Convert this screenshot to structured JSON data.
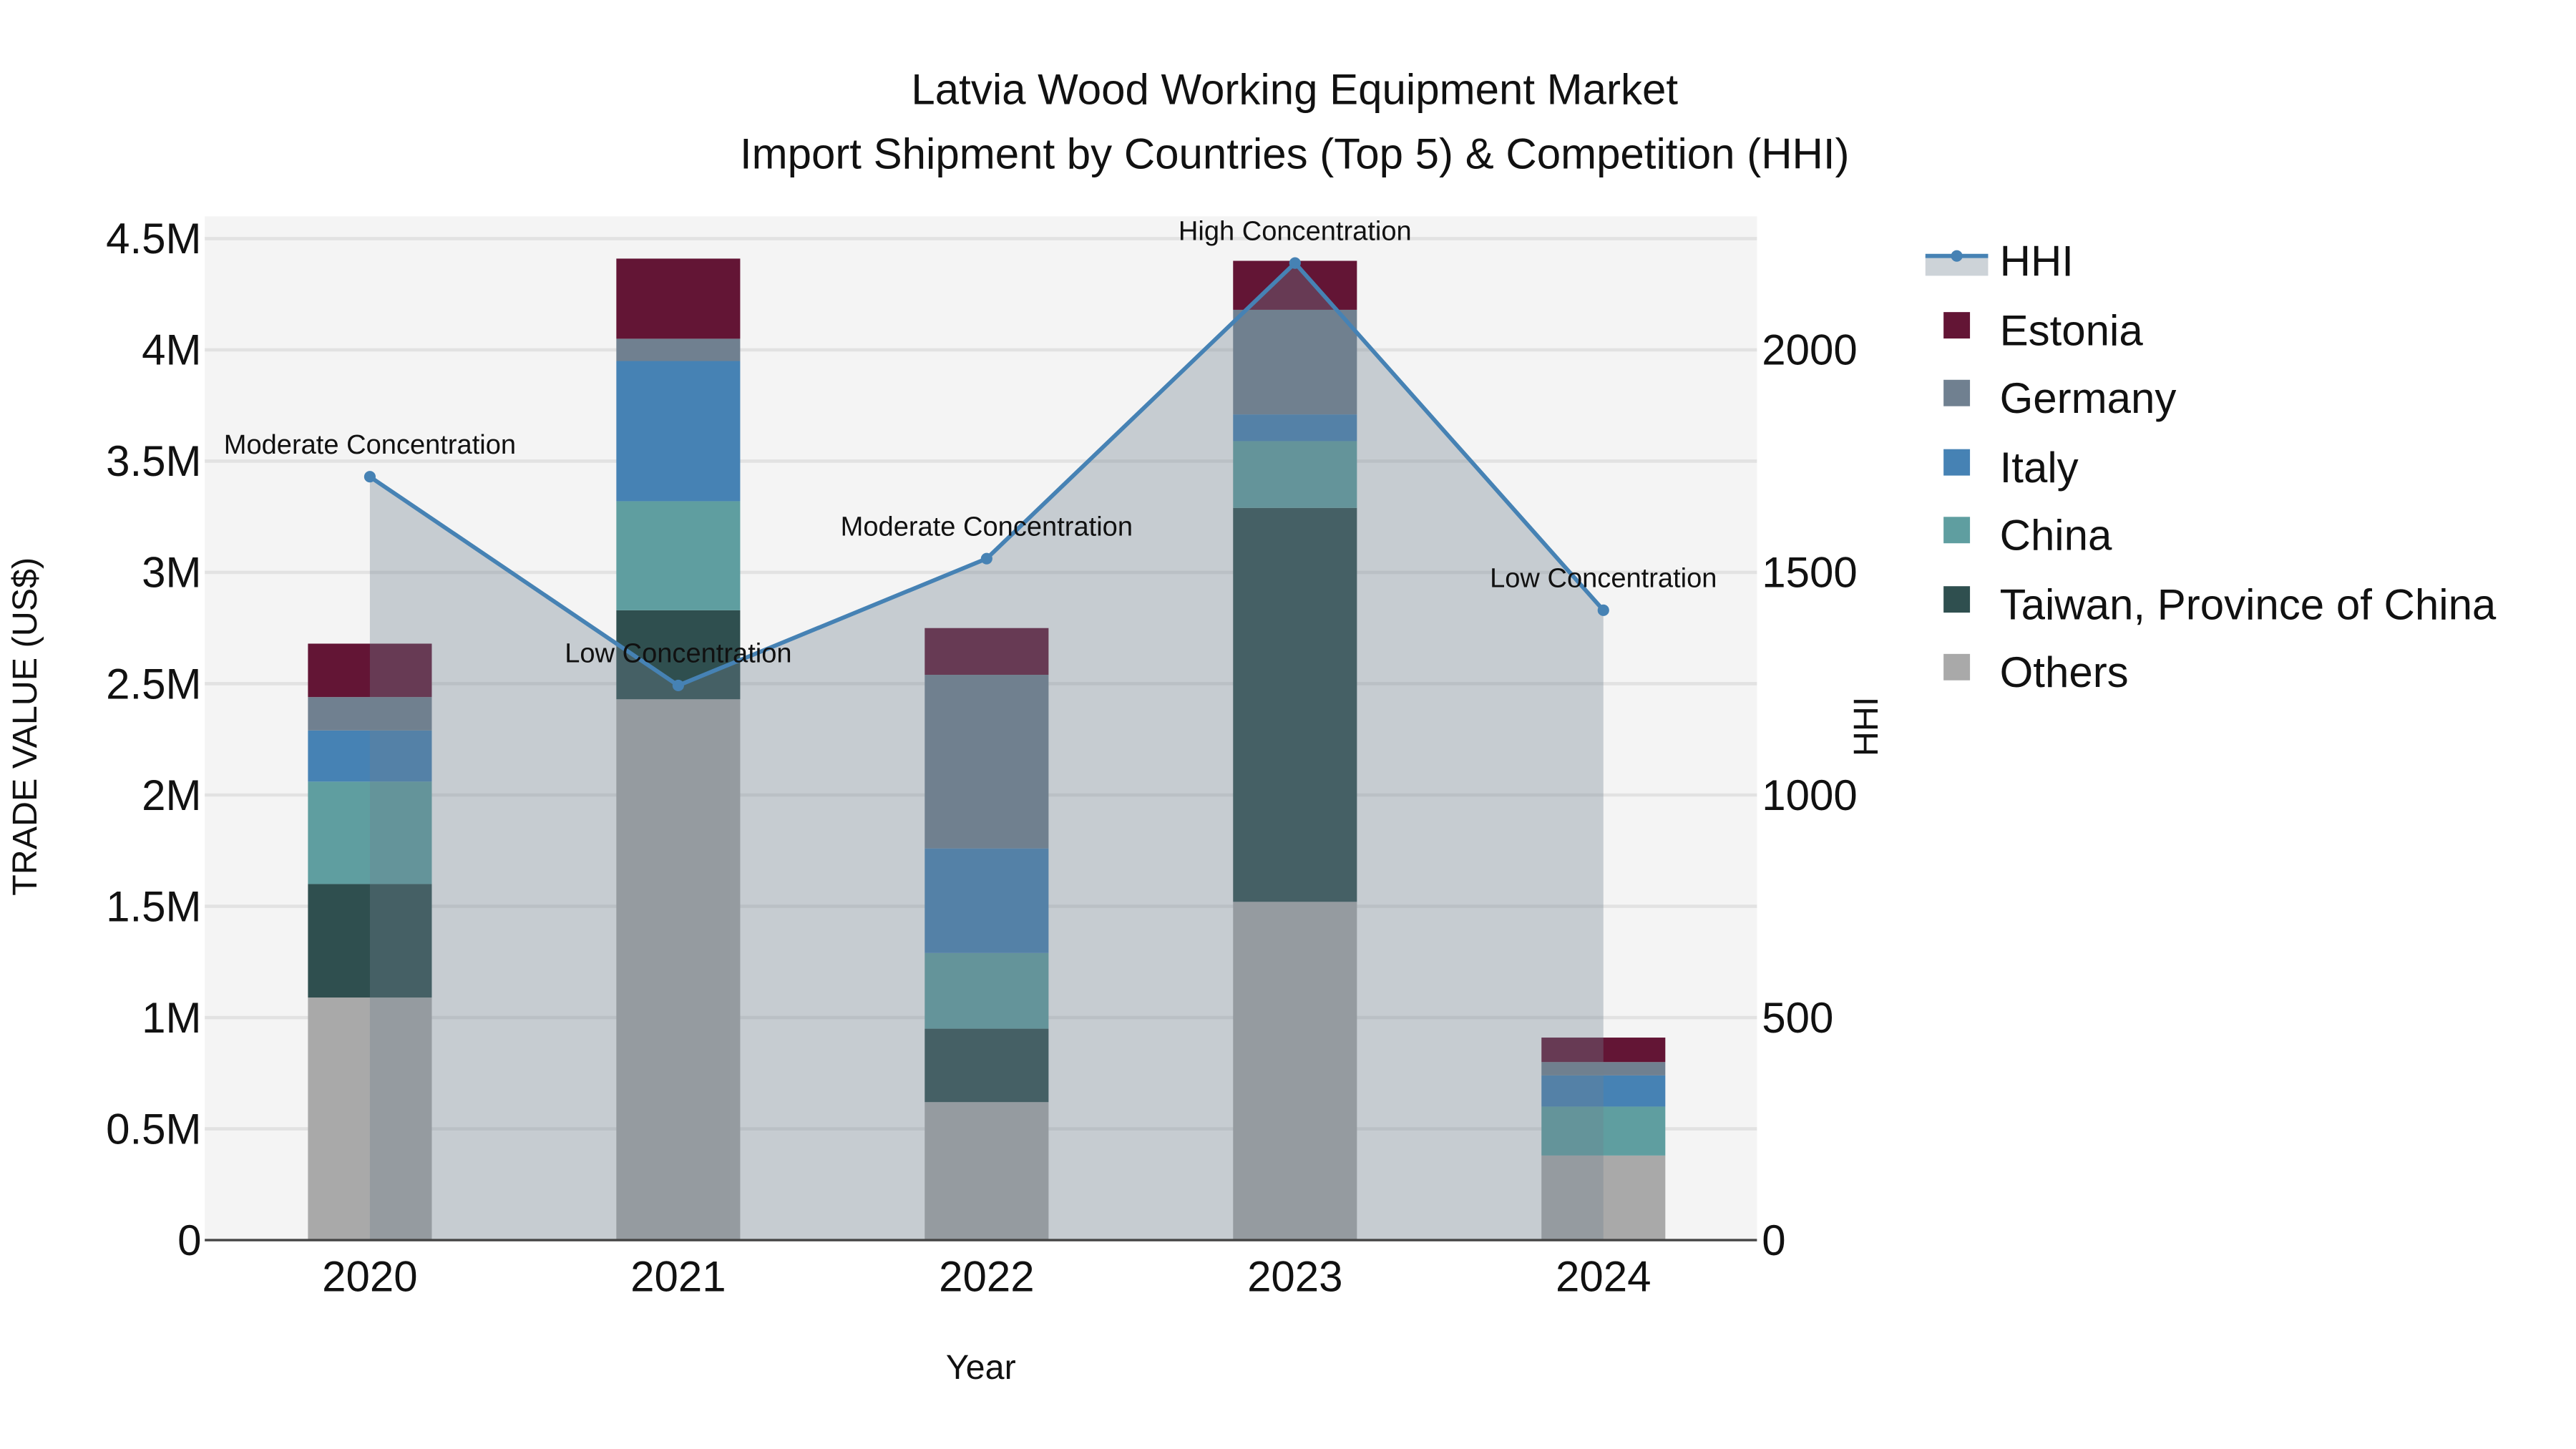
{
  "chart_data": {
    "type": "bar",
    "title": "Latvia Wood Working Equipment Market",
    "subtitle": "Import Shipment by Countries (Top 5) & Competition (HHI)",
    "xlabel": "Year",
    "ylabel": "TRADE VALUE (US$)",
    "y2label": "HHI",
    "categories": [
      "2020",
      "2021",
      "2022",
      "2023",
      "2024"
    ],
    "ylim": [
      0,
      4600000
    ],
    "y2lim": [
      0,
      2300
    ],
    "yticks": [
      {
        "value": 0,
        "label": "0"
      },
      {
        "value": 500000,
        "label": "0.5M"
      },
      {
        "value": 1000000,
        "label": "1M"
      },
      {
        "value": 1500000,
        "label": "1.5M"
      },
      {
        "value": 2000000,
        "label": "2M"
      },
      {
        "value": 2500000,
        "label": "2.5M"
      },
      {
        "value": 3000000,
        "label": "3M"
      },
      {
        "value": 3500000,
        "label": "3.5M"
      },
      {
        "value": 4000000,
        "label": "4M"
      },
      {
        "value": 4500000,
        "label": "4.5M"
      }
    ],
    "y2ticks": [
      {
        "value": 0,
        "label": "0"
      },
      {
        "value": 500,
        "label": "500"
      },
      {
        "value": 1000,
        "label": "1000"
      },
      {
        "value": 1500,
        "label": "1500"
      },
      {
        "value": 2000,
        "label": "2000"
      }
    ],
    "series": [
      {
        "name": "Others",
        "color": "#a9a9a9",
        "values": [
          1090000,
          2430000,
          620000,
          1520000,
          380000
        ]
      },
      {
        "name": "Taiwan, Province of China",
        "color": "#2f4f4f",
        "values": [
          510000,
          400000,
          330000,
          1770000,
          0
        ]
      },
      {
        "name": "China",
        "color": "#5f9ea0",
        "values": [
          460000,
          490000,
          340000,
          300000,
          220000
        ]
      },
      {
        "name": "Italy",
        "color": "#4682b4",
        "values": [
          230000,
          630000,
          470000,
          120000,
          140000
        ]
      },
      {
        "name": "Germany",
        "color": "#708090",
        "values": [
          150000,
          100000,
          780000,
          470000,
          60000
        ]
      },
      {
        "name": "Estonia",
        "color": "#631535",
        "values": [
          240000,
          360000,
          210000,
          220000,
          110000
        ]
      }
    ],
    "hhi": {
      "name": "HHI",
      "color": "#4682b4",
      "values": [
        1715,
        1246,
        1531,
        2195,
        1415
      ],
      "annotations": [
        "Moderate Concentration",
        "Low Concentration",
        "Moderate Concentration",
        "High Concentration",
        "Low Concentration"
      ]
    },
    "legend": {
      "placement": "right",
      "entries": [
        "HHI",
        "Estonia",
        "Germany",
        "Italy",
        "China",
        "Taiwan, Province of China",
        "Others"
      ]
    },
    "grid": true
  }
}
